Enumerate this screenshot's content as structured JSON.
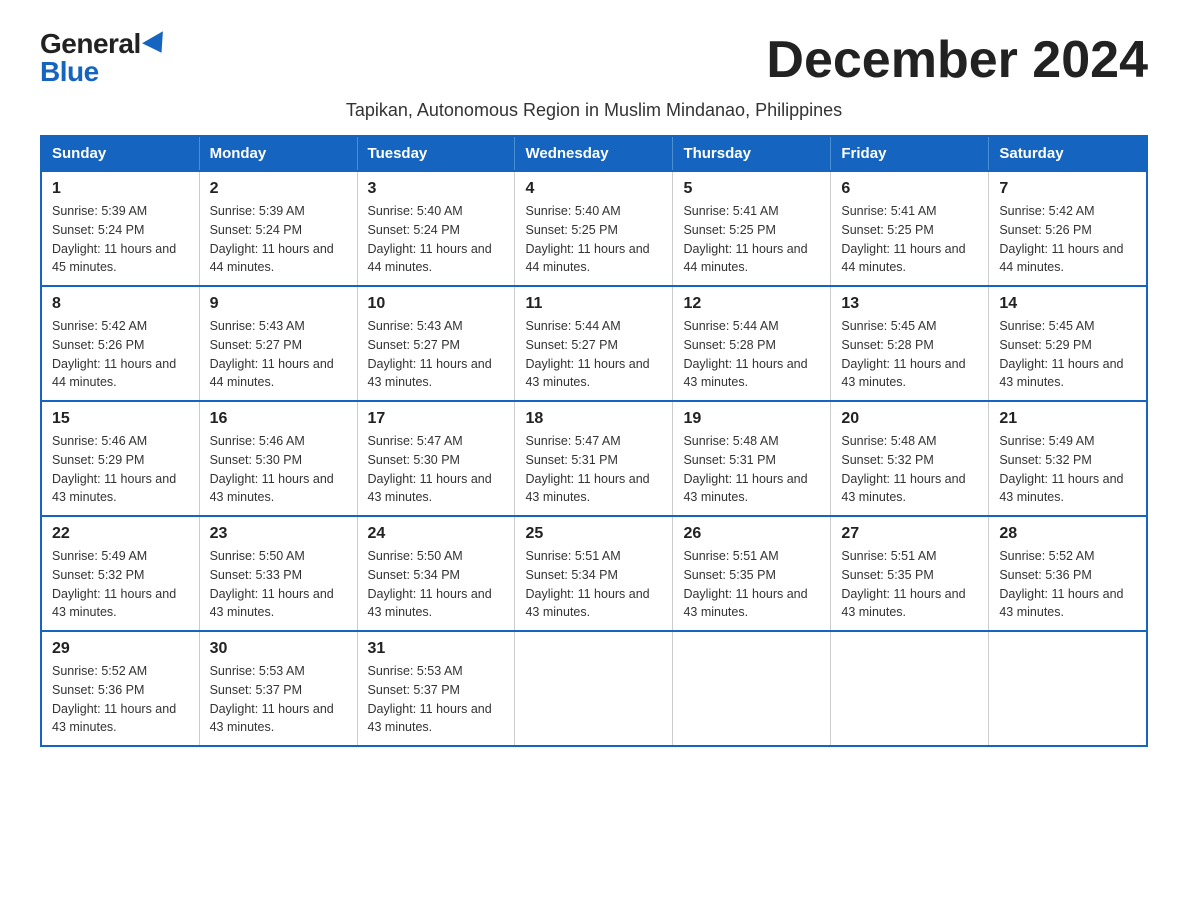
{
  "logo": {
    "general": "General",
    "blue": "Blue"
  },
  "title": "December 2024",
  "subtitle": "Tapikan, Autonomous Region in Muslim Mindanao, Philippines",
  "headers": [
    "Sunday",
    "Monday",
    "Tuesday",
    "Wednesday",
    "Thursday",
    "Friday",
    "Saturday"
  ],
  "weeks": [
    [
      {
        "day": "1",
        "sunrise": "5:39 AM",
        "sunset": "5:24 PM",
        "daylight": "11 hours and 45 minutes."
      },
      {
        "day": "2",
        "sunrise": "5:39 AM",
        "sunset": "5:24 PM",
        "daylight": "11 hours and 44 minutes."
      },
      {
        "day": "3",
        "sunrise": "5:40 AM",
        "sunset": "5:24 PM",
        "daylight": "11 hours and 44 minutes."
      },
      {
        "day": "4",
        "sunrise": "5:40 AM",
        "sunset": "5:25 PM",
        "daylight": "11 hours and 44 minutes."
      },
      {
        "day": "5",
        "sunrise": "5:41 AM",
        "sunset": "5:25 PM",
        "daylight": "11 hours and 44 minutes."
      },
      {
        "day": "6",
        "sunrise": "5:41 AM",
        "sunset": "5:25 PM",
        "daylight": "11 hours and 44 minutes."
      },
      {
        "day": "7",
        "sunrise": "5:42 AM",
        "sunset": "5:26 PM",
        "daylight": "11 hours and 44 minutes."
      }
    ],
    [
      {
        "day": "8",
        "sunrise": "5:42 AM",
        "sunset": "5:26 PM",
        "daylight": "11 hours and 44 minutes."
      },
      {
        "day": "9",
        "sunrise": "5:43 AM",
        "sunset": "5:27 PM",
        "daylight": "11 hours and 44 minutes."
      },
      {
        "day": "10",
        "sunrise": "5:43 AM",
        "sunset": "5:27 PM",
        "daylight": "11 hours and 43 minutes."
      },
      {
        "day": "11",
        "sunrise": "5:44 AM",
        "sunset": "5:27 PM",
        "daylight": "11 hours and 43 minutes."
      },
      {
        "day": "12",
        "sunrise": "5:44 AM",
        "sunset": "5:28 PM",
        "daylight": "11 hours and 43 minutes."
      },
      {
        "day": "13",
        "sunrise": "5:45 AM",
        "sunset": "5:28 PM",
        "daylight": "11 hours and 43 minutes."
      },
      {
        "day": "14",
        "sunrise": "5:45 AM",
        "sunset": "5:29 PM",
        "daylight": "11 hours and 43 minutes."
      }
    ],
    [
      {
        "day": "15",
        "sunrise": "5:46 AM",
        "sunset": "5:29 PM",
        "daylight": "11 hours and 43 minutes."
      },
      {
        "day": "16",
        "sunrise": "5:46 AM",
        "sunset": "5:30 PM",
        "daylight": "11 hours and 43 minutes."
      },
      {
        "day": "17",
        "sunrise": "5:47 AM",
        "sunset": "5:30 PM",
        "daylight": "11 hours and 43 minutes."
      },
      {
        "day": "18",
        "sunrise": "5:47 AM",
        "sunset": "5:31 PM",
        "daylight": "11 hours and 43 minutes."
      },
      {
        "day": "19",
        "sunrise": "5:48 AM",
        "sunset": "5:31 PM",
        "daylight": "11 hours and 43 minutes."
      },
      {
        "day": "20",
        "sunrise": "5:48 AM",
        "sunset": "5:32 PM",
        "daylight": "11 hours and 43 minutes."
      },
      {
        "day": "21",
        "sunrise": "5:49 AM",
        "sunset": "5:32 PM",
        "daylight": "11 hours and 43 minutes."
      }
    ],
    [
      {
        "day": "22",
        "sunrise": "5:49 AM",
        "sunset": "5:32 PM",
        "daylight": "11 hours and 43 minutes."
      },
      {
        "day": "23",
        "sunrise": "5:50 AM",
        "sunset": "5:33 PM",
        "daylight": "11 hours and 43 minutes."
      },
      {
        "day": "24",
        "sunrise": "5:50 AM",
        "sunset": "5:34 PM",
        "daylight": "11 hours and 43 minutes."
      },
      {
        "day": "25",
        "sunrise": "5:51 AM",
        "sunset": "5:34 PM",
        "daylight": "11 hours and 43 minutes."
      },
      {
        "day": "26",
        "sunrise": "5:51 AM",
        "sunset": "5:35 PM",
        "daylight": "11 hours and 43 minutes."
      },
      {
        "day": "27",
        "sunrise": "5:51 AM",
        "sunset": "5:35 PM",
        "daylight": "11 hours and 43 minutes."
      },
      {
        "day": "28",
        "sunrise": "5:52 AM",
        "sunset": "5:36 PM",
        "daylight": "11 hours and 43 minutes."
      }
    ],
    [
      {
        "day": "29",
        "sunrise": "5:52 AM",
        "sunset": "5:36 PM",
        "daylight": "11 hours and 43 minutes."
      },
      {
        "day": "30",
        "sunrise": "5:53 AM",
        "sunset": "5:37 PM",
        "daylight": "11 hours and 43 minutes."
      },
      {
        "day": "31",
        "sunrise": "5:53 AM",
        "sunset": "5:37 PM",
        "daylight": "11 hours and 43 minutes."
      },
      null,
      null,
      null,
      null
    ]
  ]
}
